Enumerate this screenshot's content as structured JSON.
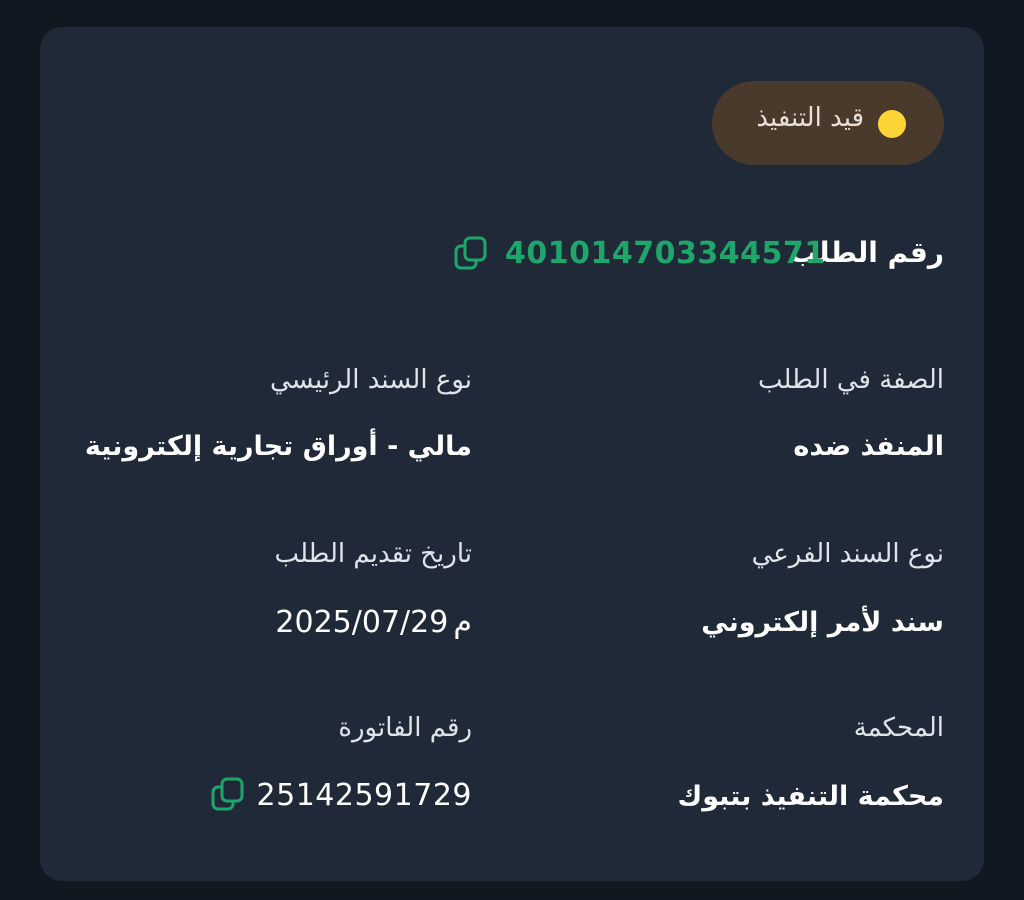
{
  "status": {
    "label": "قيد التنفيذ",
    "dot_color": "#fcd535",
    "icon": "status-dot"
  },
  "request": {
    "label": "رقم الطلب",
    "number": "401014703344571",
    "copy_icon": "copy-icon"
  },
  "fields": {
    "role_label": "الصفة في الطلب",
    "role_value": "المنفذ ضده",
    "main_instrument_label": "نوع السند الرئيسي",
    "main_instrument_value": "مالي - أوراق تجارية إلكترونية",
    "sub_instrument_label": "نوع السند الفرعي",
    "sub_instrument_value": "سند لأمر إلكتروني",
    "submit_date_label": "تاريخ تقديم الطلب",
    "submit_date_value": "2025/07/29",
    "submit_date_suffix": "م",
    "court_label": "المحكمة",
    "court_value": "محكمة التنفيذ بتبوك",
    "invoice_label": "رقم الفاتورة",
    "invoice_value": "25142591729"
  },
  "colors": {
    "background": "#121821",
    "card": "#1f2937",
    "accent_green": "#1ea66b",
    "status_pill": "#4a3a2c"
  }
}
